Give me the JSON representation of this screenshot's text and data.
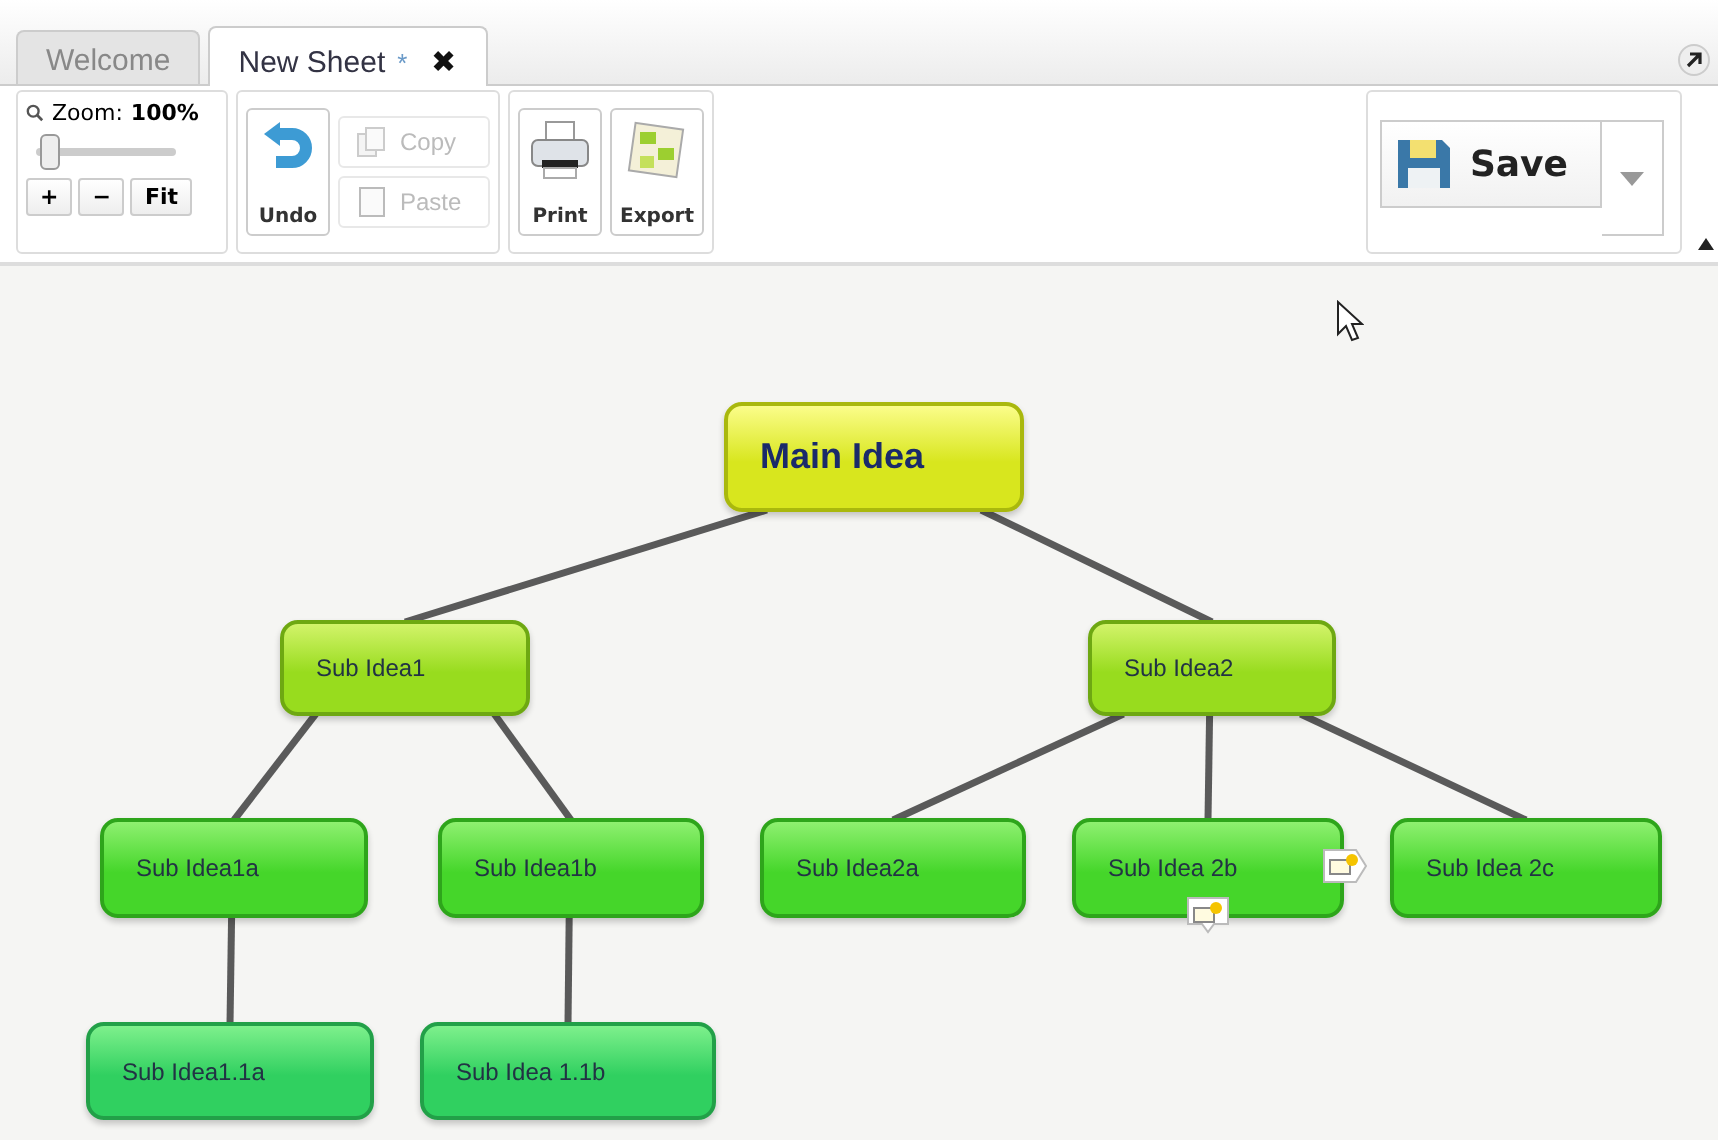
{
  "tabs": [
    {
      "label": "Welcome",
      "selected": false
    },
    {
      "label": "New Sheet",
      "modified_mark": "*",
      "close": "✖",
      "selected": true
    }
  ],
  "toolbar": {
    "zoom": {
      "label": "Zoom:",
      "value": "100%",
      "level": 0.1,
      "buttons": [
        "+",
        "−",
        "Fit"
      ]
    },
    "undo": {
      "label": "Undo"
    },
    "clipboard": [
      {
        "label": "Copy",
        "kind": "copy",
        "disabled": true
      },
      {
        "label": "Paste",
        "kind": "paste",
        "disabled": true
      }
    ],
    "output": [
      {
        "label": "Print",
        "kind": "print"
      },
      {
        "label": "Export",
        "kind": "export"
      }
    ],
    "save": {
      "label": "Save"
    }
  },
  "map": {
    "label": "Main Idea",
    "children": [
      {
        "label": "Sub Idea1",
        "children": [
          {
            "label": "Sub Idea1a",
            "children": [
              {
                "label": "Sub Idea1.1a"
              }
            ]
          },
          {
            "label": "Sub Idea1b",
            "children": [
              {
                "label": "Sub Idea 1.1b"
              }
            ]
          }
        ]
      },
      {
        "label": "Sub Idea2",
        "children": [
          {
            "label": "Sub Idea2a"
          },
          {
            "label": "Sub Idea 2b",
            "side_note": true,
            "bottom_note": true
          },
          {
            "label": "Sub Idea 2c"
          }
        ]
      }
    ]
  }
}
